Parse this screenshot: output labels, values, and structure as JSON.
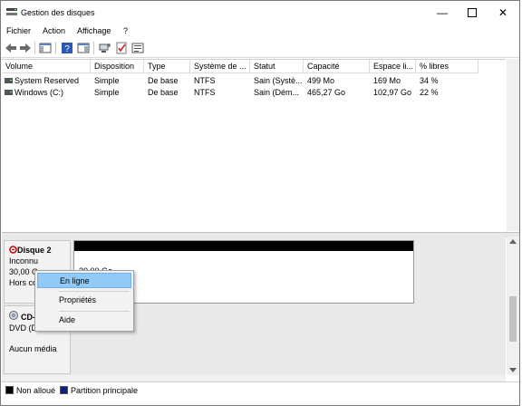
{
  "window": {
    "title": "Gestion des disques"
  },
  "menu": {
    "items": [
      "Fichier",
      "Action",
      "Affichage",
      "?"
    ]
  },
  "table": {
    "headers": [
      "Volume",
      "Disposition",
      "Type",
      "Système de ...",
      "Statut",
      "Capacité",
      "Espace li...",
      "% libres"
    ],
    "rows": [
      [
        "System Reserved",
        "Simple",
        "De base",
        "NTFS",
        "Sain (Systè...",
        "499 Mo",
        "169 Mo",
        "34 %"
      ],
      [
        "Windows (C:)",
        "Simple",
        "De base",
        "NTFS",
        "Sain (Dém...",
        "465,27 Go",
        "102,97 Go",
        "22 %"
      ]
    ]
  },
  "disks": {
    "disk2": {
      "name": "Disque 2",
      "type": "Inconnu",
      "size": "30,00 Go",
      "status": "Hors co",
      "partition_size": "30,00 Go"
    },
    "cdrom": {
      "name": "CD-",
      "type": "DVD (D:",
      "status": "Aucun média"
    }
  },
  "context_menu": {
    "items": [
      "En ligne",
      "Propriétés",
      "Aide"
    ]
  },
  "legend": {
    "items": [
      "Non alloué",
      "Partition principale"
    ]
  },
  "colors": {
    "unallocated": "#000000",
    "primary_partition": "#0b1f8f",
    "menu_highlight": "#91c9f7",
    "offline_icon": "#d00000"
  }
}
